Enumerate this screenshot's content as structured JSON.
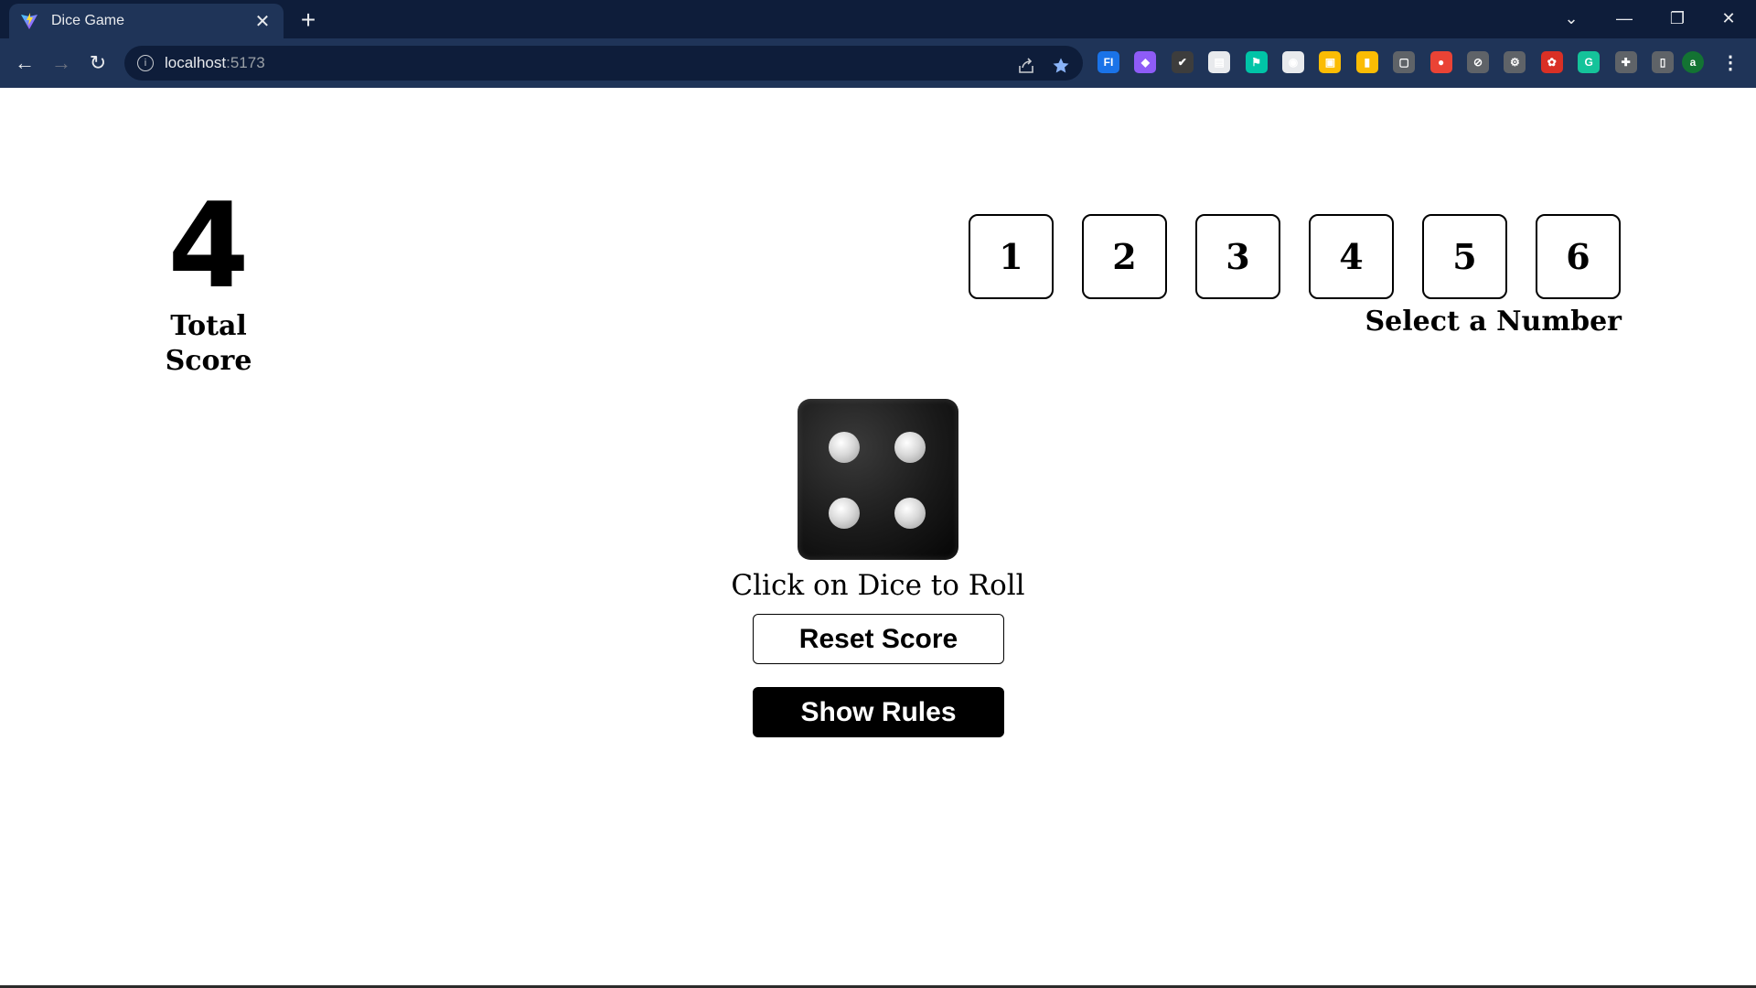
{
  "browser": {
    "tab_title": "Dice Game",
    "tab_close": "✕",
    "new_tab": "+",
    "url_host": "localhost",
    "url_port": ":5173",
    "window": {
      "minimize": "—",
      "restore": "❐",
      "close": "✕",
      "tabs_menu": "⌄"
    },
    "nav": {
      "back": "←",
      "forward": "→",
      "reload": "↻"
    },
    "icons": [
      "share-icon",
      "bookmark-star-icon"
    ],
    "extensions": [
      {
        "name": "ext-fi-icon",
        "color": "#1a73e8",
        "glyph": "FI"
      },
      {
        "name": "ext-purple-icon",
        "color": "#8e5cf7",
        "glyph": "◆"
      },
      {
        "name": "ext-check-icon",
        "color": "#3d3d3d",
        "glyph": "✔"
      },
      {
        "name": "ext-calendar-icon",
        "color": "#e8eaed",
        "glyph": "▤"
      },
      {
        "name": "ext-flag-icon",
        "color": "#00c4a7",
        "glyph": "⚑"
      },
      {
        "name": "ext-circle-icon",
        "color": "#e8eaed",
        "glyph": "◉"
      },
      {
        "name": "ext-yellow-icon",
        "color": "#fbbc04",
        "glyph": "▣"
      },
      {
        "name": "ext-keep-icon",
        "color": "#fbbc04",
        "glyph": "▮"
      },
      {
        "name": "ext-grey-icon",
        "color": "#5f6368",
        "glyph": "▢"
      },
      {
        "name": "ext-color-icon",
        "color": "#ea4335",
        "glyph": "●"
      },
      {
        "name": "ext-compass-icon",
        "color": "#5f6368",
        "glyph": "⊘"
      },
      {
        "name": "ext-gear-icon",
        "color": "#5f6368",
        "glyph": "⚙"
      },
      {
        "name": "ext-red-icon",
        "color": "#d93025",
        "glyph": "✿"
      },
      {
        "name": "ext-grammarly-icon",
        "color": "#15c39a",
        "glyph": "G"
      },
      {
        "name": "ext-puzzle-icon",
        "color": "#5f6368",
        "glyph": "✚"
      },
      {
        "name": "ext-sidepanel-icon",
        "color": "#5f6368",
        "glyph": "▯"
      }
    ],
    "profile_initial": "a",
    "profile_color": "#137333",
    "menu": "⋮"
  },
  "game": {
    "total_score": "4",
    "total_score_label": "Total Score",
    "numbers": [
      "1",
      "2",
      "3",
      "4",
      "5",
      "6"
    ],
    "select_label": "Select a Number",
    "dice_value": 4,
    "dice_caption": "Click on Dice to Roll",
    "reset_button": "Reset Score",
    "rules_button": "Show Rules"
  }
}
